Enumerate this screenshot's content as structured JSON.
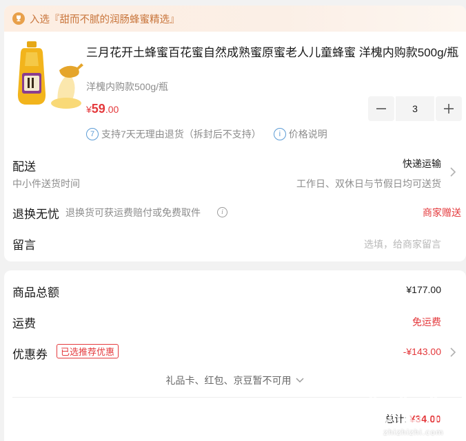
{
  "banner": {
    "text": "入选『甜而不腻的润肠蜂蜜精选』"
  },
  "product": {
    "title": "三月花开土蜂蜜百花蜜自然成熟蜜原蜜老人儿童蜂蜜 洋槐内购款500g/瓶",
    "spec": "洋槐内购款500g/瓶",
    "price_symbol": "¥",
    "price_int": "59",
    "price_dec": ".00",
    "quantity": "3",
    "service_return_icon": "7",
    "service_return": "支持7天无理由退货（拆封后不支持）",
    "service_price_icon": "i",
    "service_price": "价格说明"
  },
  "delivery": {
    "label": "配送",
    "sub": "中小件送货时间",
    "method": "快递运输",
    "time": "工作日、双休日与节假日均可送货"
  },
  "return_service": {
    "label": "退换无忧",
    "desc": "退换货可获运费赔付或免费取件",
    "right": "商家赠送"
  },
  "message": {
    "label": "留言",
    "placeholder": "选填，给商家留言"
  },
  "summary": {
    "total_label": "商品总额",
    "total_value": "¥177.00",
    "shipping_label": "运费",
    "shipping_value": "免运费",
    "coupon_label": "优惠券",
    "coupon_badge": "已选推荐优惠",
    "coupon_value": "-¥143.00",
    "unavailable": "礼品卡、红包、京豆暂不可用",
    "grand_label": "总计:",
    "grand_value": "¥34.00"
  },
  "watermark": {
    "text": "zhizhizhi.com"
  },
  "colors": {
    "accent_red": "#e4393c",
    "banner_text": "#c8743a",
    "info_blue": "#5b9bd5"
  }
}
